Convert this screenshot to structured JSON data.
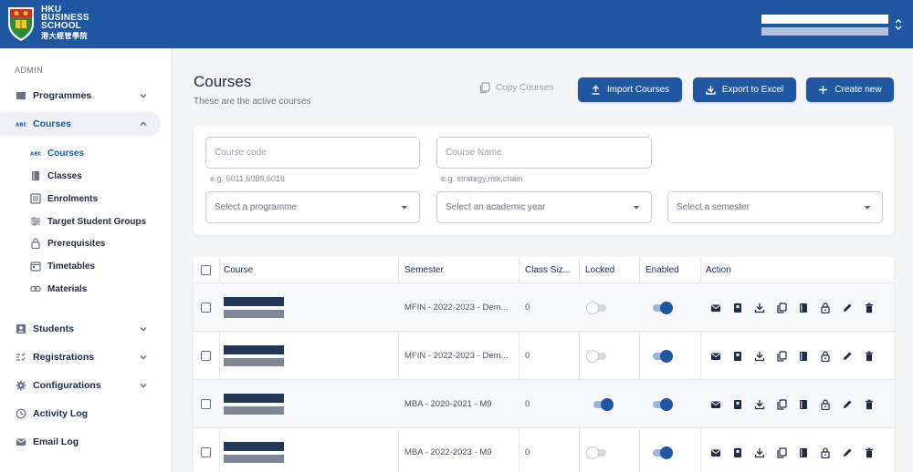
{
  "header": {
    "logo_line1": "HKU",
    "logo_line2": "BUSINESS",
    "logo_line3": "SCHOOL",
    "logo_cn": "港大經管學院",
    "brand_color": "#1f57a3"
  },
  "sidebar": {
    "section": "ADMIN",
    "items": [
      {
        "label": "Programmes",
        "icon": "book-icon"
      },
      {
        "label": "Courses",
        "icon": "abc-icon"
      },
      {
        "label": "Students",
        "icon": "id-card-icon"
      },
      {
        "label": "Registrations",
        "icon": "registration-icon"
      },
      {
        "label": "Configurations",
        "icon": "gear-icon"
      },
      {
        "label": "Activity Log",
        "icon": "history-icon"
      },
      {
        "label": "Email Log",
        "icon": "mail-icon"
      }
    ],
    "sub_items": [
      {
        "label": "Courses",
        "icon": "abc-icon"
      },
      {
        "label": "Classes",
        "icon": "class-book-icon"
      },
      {
        "label": "Enrolments",
        "icon": "list-icon"
      },
      {
        "label": "Target Student Groups",
        "icon": "filter-icon"
      },
      {
        "label": "Prerequisites",
        "icon": "lock-icon"
      },
      {
        "label": "Timetables",
        "icon": "calendar-icon"
      },
      {
        "label": "Materials",
        "icon": "link-icon"
      }
    ]
  },
  "main": {
    "title": "Courses",
    "subtitle": "These are the active courses",
    "copy_label": "Copy Courses",
    "import_label": "Import Courses",
    "export_label": "Export to Excel",
    "create_label": "Create new"
  },
  "filters": {
    "course_code_placeholder": "Course code",
    "course_code_helper": "e.g. 6011,6089,6016",
    "course_name_placeholder": "Course Name",
    "course_name_helper": "e.g. strategy,risk,chain",
    "programme_placeholder": "Select a programme",
    "year_placeholder": "Select an academic year",
    "semester_placeholder": "Select a semester"
  },
  "table": {
    "columns": [
      "Course",
      "Semester",
      "Class Siz...",
      "Locked",
      "Enabled",
      "Action"
    ],
    "rows": [
      {
        "semester": "MFIN - 2022-2023 - Dem...",
        "class_size": "0",
        "locked": false,
        "enabled": true
      },
      {
        "semester": "MFIN - 2022-2023 - Dem...",
        "class_size": "0",
        "locked": false,
        "enabled": true
      },
      {
        "semester": "MBA - 2020-2021 - M9",
        "class_size": "0",
        "locked": true,
        "enabled": true
      },
      {
        "semester": "MBA - 2022-2023 - M9",
        "class_size": "0",
        "locked": false,
        "enabled": true
      }
    ],
    "actions": [
      "email-icon",
      "bookmark-icon",
      "download-icon",
      "copy-icon",
      "book-icon",
      "lock-icon",
      "edit-icon",
      "delete-icon"
    ]
  }
}
